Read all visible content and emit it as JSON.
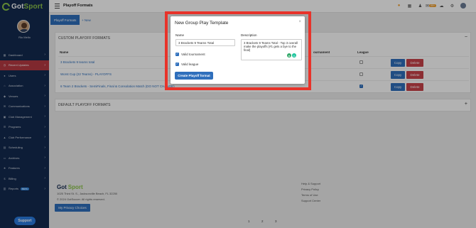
{
  "app": {
    "logo_main": "Got",
    "logo_accent": "Sport",
    "user_name": "Rio Mello"
  },
  "sidebar": {
    "items": [
      {
        "label": "Dashboard",
        "icon": "dashboard-icon"
      },
      {
        "label": "Recent Updates",
        "icon": "clock-icon",
        "active": true
      },
      {
        "label": "Users",
        "icon": "users-icon"
      },
      {
        "label": "Association",
        "icon": "association-icon"
      },
      {
        "label": "Venues",
        "icon": "venue-icon"
      },
      {
        "label": "Communications",
        "icon": "chat-icon"
      },
      {
        "label": "Club Management",
        "icon": "club-icon"
      },
      {
        "label": "Programs",
        "icon": "programs-icon"
      },
      {
        "label": "Club Performance",
        "icon": "chart-icon"
      },
      {
        "label": "Scheduling",
        "icon": "calendar-icon"
      },
      {
        "label": "Archives",
        "icon": "archive-icon"
      },
      {
        "label": "Features",
        "icon": "star-icon"
      },
      {
        "label": "Billing",
        "icon": "billing-icon"
      },
      {
        "label": "Reports",
        "icon": "reports-icon",
        "badge": "BETA"
      }
    ],
    "support_label": "Support"
  },
  "header": {
    "title": "Playoff Formats",
    "notification_count": "99+"
  },
  "tabs": {
    "active": "Playoff Formats",
    "new": "+ New"
  },
  "custom_section": {
    "title": "CUSTOM PLAYOFF FORMATS",
    "toggle": "−",
    "columns": {
      "name": "Name",
      "tournament": "ournament",
      "league": "League"
    },
    "rows": [
      {
        "name": "3 Brackets 9 teams total",
        "league": false
      },
      {
        "name": "Worst Cup (22 Teams) - PLAYOFFS",
        "league": false
      },
      {
        "name": "6 Team 2 Brackets - SemiFinals, Final & Consolation Match (DO NOT CHANGE)",
        "league": true
      }
    ],
    "copy_label": "Copy",
    "delete_label": "Delete"
  },
  "default_section": {
    "title": "DEFAULT PLAYOFF FORMATS",
    "toggle": "+"
  },
  "footer": {
    "logo_main": "Got",
    "logo_accent": "Sport",
    "address": "1025 Third St. S., Jacksonville Beach, FL 32250",
    "copyright": "© 2024 GotSoccer. All rights reserved.",
    "privacy_button": "My Privacy Choices",
    "links": [
      "Help & Support",
      "Privacy Policy",
      "Terms of Use",
      "Support Center"
    ],
    "pages": [
      "1",
      "2",
      "3"
    ]
  },
  "colors": {
    "sidebar": "#132a4f",
    "primary": "#2f6fbc",
    "danger": "#c9424a",
    "highlight": "#e8332a",
    "brand_green": "#8bc34a"
  },
  "modal": {
    "title": "New Group Play Template",
    "close": "×",
    "name_label": "Name",
    "name_value": "3 Brackets 9 Teams Total",
    "description_label": "Description",
    "description_value": "3 Brackets 9 Teams Total - Top 3 overall make the playoffs (#1 gets a bye to the final)",
    "valid_tournament": "Valid tournament",
    "valid_league": "Valid league",
    "submit": "Create Playoff format"
  }
}
